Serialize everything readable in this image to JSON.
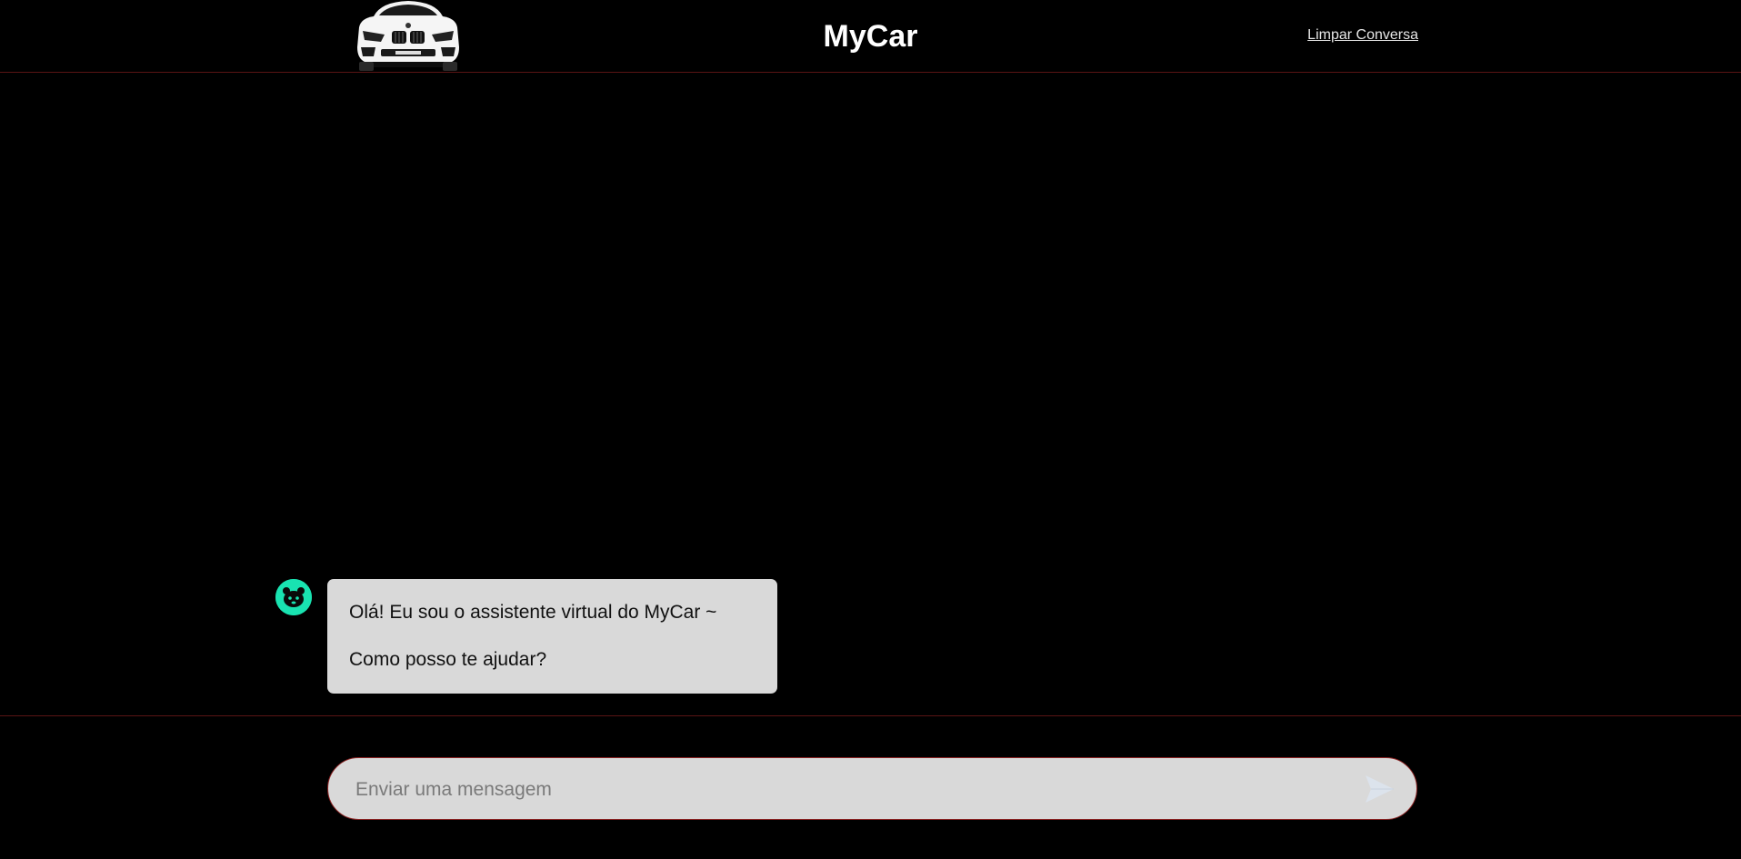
{
  "header": {
    "title": "MyCar",
    "clear_label": "Limpar Conversa",
    "logo_icon": "car-front-icon"
  },
  "chat": {
    "messages": [
      {
        "sender": "bot",
        "avatar_icon": "bot-face-icon",
        "lines": [
          "Olá! Eu sou o assistente virtual do MyCar ~",
          "Como posso te ajudar?"
        ]
      }
    ]
  },
  "composer": {
    "placeholder": "Enviar uma mensagem",
    "value": "",
    "send_icon": "send-icon"
  },
  "colors": {
    "background": "#000000",
    "divider": "#5a1414",
    "bubble": "#d9d9d9",
    "avatar": "#19e3b1",
    "input_border": "#8a2222"
  }
}
